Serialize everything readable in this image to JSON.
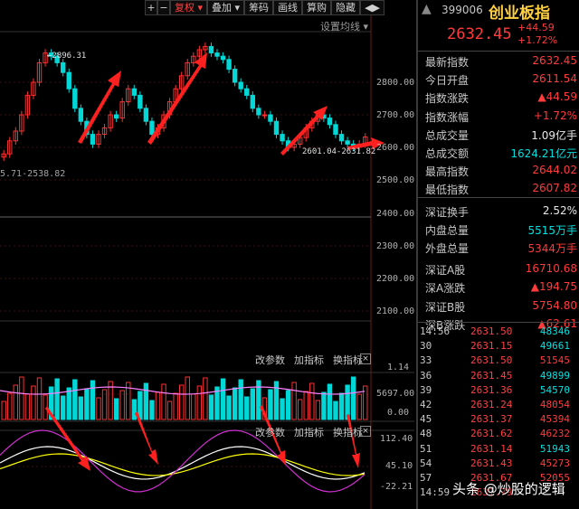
{
  "toolbar": {
    "plus": "+",
    "minus": "−",
    "fuquan": "复权",
    "diejia": "叠加",
    "choumа": "筹码",
    "huaxian": "画线",
    "paigou": "算购",
    "yincang": "隐藏",
    "more": "◀▶"
  },
  "setline_label": "设置均线 ▾",
  "price_axis": [
    "2800.00",
    "2700.00",
    "2600.00",
    "2500.00",
    "2400.00",
    "2300.00",
    "2200.00",
    "2100.00"
  ],
  "range_label": "5.71-2538.82",
  "high_label": "2896.31",
  "low_label": "2601.04-2631.82",
  "vol_axis": [
    "1.14",
    "5697.00",
    "0.00"
  ],
  "ind_axis": [
    "112.40",
    "45.10",
    "-22.21"
  ],
  "panel1": {
    "a": "改参数",
    "b": "加指标",
    "c": "换指标",
    "close": "×"
  },
  "panel2": {
    "a": "改参数",
    "b": "加指标",
    "c": "换指标",
    "close": "×"
  },
  "quote": {
    "code": "399006",
    "name": "创业板指",
    "price": "2632.45",
    "chg": "+44.59",
    "pct": "+1.72%",
    "rows": [
      {
        "k": "最新指数",
        "v": "2632.45",
        "c": "red"
      },
      {
        "k": "今日开盘",
        "v": "2611.54",
        "c": "red"
      },
      {
        "k": "指数涨跌",
        "v": "▲44.59",
        "c": "red"
      },
      {
        "k": "指数涨幅",
        "v": "+1.72%",
        "c": "red"
      },
      {
        "k": "总成交量",
        "v": "1.09亿手",
        "c": "white"
      },
      {
        "k": "总成交额",
        "v": "1624.21亿元",
        "c": "green"
      },
      {
        "k": "最高指数",
        "v": "2644.02",
        "c": "red"
      },
      {
        "k": "最低指数",
        "v": "2607.82",
        "c": "red"
      },
      {
        "k": "深证换手",
        "v": "2.52%",
        "c": "white"
      },
      {
        "k": "内盘总量",
        "v": "5515万手",
        "c": "green"
      },
      {
        "k": "外盘总量",
        "v": "5344万手",
        "c": "red"
      },
      {
        "k": "深证A股",
        "v": "16710.68",
        "c": "red"
      },
      {
        "k": "深A涨跌",
        "v": "▲194.75",
        "c": "red"
      },
      {
        "k": "深证B股",
        "v": "5754.80",
        "c": "red"
      },
      {
        "k": "深B涨跌",
        "v": "▲62.61",
        "c": "red"
      }
    ],
    "ticks": [
      {
        "t": "14:56",
        "p": "2631.50",
        "v": "48346",
        "c": "green"
      },
      {
        "t": "30",
        "p": "2631.15",
        "v": "49661",
        "c": "green"
      },
      {
        "t": "33",
        "p": "2631.50",
        "v": "51545",
        "c": "red"
      },
      {
        "t": "36",
        "p": "2631.45",
        "v": "49899",
        "c": "green"
      },
      {
        "t": "39",
        "p": "2631.36",
        "v": "54570",
        "c": "green"
      },
      {
        "t": "42",
        "p": "2631.24",
        "v": "48054",
        "c": "red"
      },
      {
        "t": "45",
        "p": "2631.37",
        "v": "45394",
        "c": "red"
      },
      {
        "t": "48",
        "p": "2631.62",
        "v": "46232",
        "c": "red"
      },
      {
        "t": "51",
        "p": "2631.14",
        "v": "51943",
        "c": "green"
      },
      {
        "t": "54",
        "p": "2631.43",
        "v": "45273",
        "c": "red"
      },
      {
        "t": "57",
        "p": "2631.67",
        "v": "52055",
        "c": "red"
      },
      {
        "t": "14:59",
        "p": "2631.79",
        "v": "",
        "c": "red"
      }
    ]
  },
  "watermark": "头条 @炒股的逻辑"
}
